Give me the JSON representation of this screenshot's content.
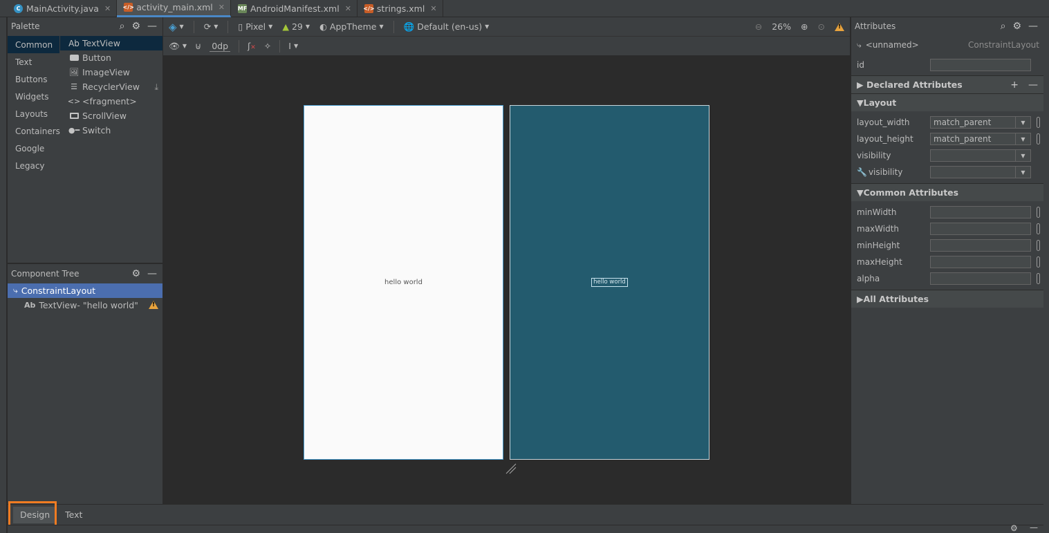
{
  "tabs": [
    {
      "label": "MainActivity.java",
      "icon": "java-class-icon",
      "active": false
    },
    {
      "label": "activity_main.xml",
      "icon": "layout-xml-icon",
      "active": true
    },
    {
      "label": "AndroidManifest.xml",
      "icon": "manifest-icon",
      "active": false
    },
    {
      "label": "strings.xml",
      "icon": "values-xml-icon",
      "active": false
    }
  ],
  "palette": {
    "title": "Palette",
    "categories": [
      "Common",
      "Text",
      "Buttons",
      "Widgets",
      "Layouts",
      "Containers",
      "Google",
      "Legacy"
    ],
    "selected_category": "Common",
    "items": [
      {
        "label": "TextView",
        "icon": "Ab"
      },
      {
        "label": "Button",
        "icon": "button-icon"
      },
      {
        "label": "ImageView",
        "icon": "image-icon"
      },
      {
        "label": "RecyclerView",
        "icon": "list-icon"
      },
      {
        "label": "<fragment>",
        "icon": "code-icon"
      },
      {
        "label": "ScrollView",
        "icon": "scroll-icon"
      },
      {
        "label": "Switch",
        "icon": "switch-icon"
      }
    ]
  },
  "component_tree": {
    "title": "Component Tree",
    "root": "ConstraintLayout",
    "child": "TextView- \"hello world\"",
    "child_icon": "Ab"
  },
  "toolbar": {
    "device": "Pixel",
    "api": "29",
    "theme": "AppTheme",
    "locale": "Default (en-us)",
    "zoom": "26%",
    "margin": "0dp"
  },
  "canvas": {
    "design_text": "hello world",
    "blueprint_text": "hello world"
  },
  "attributes": {
    "title": "Attributes",
    "component_name": "<unnamed>",
    "component_type": "ConstraintLayout",
    "id_label": "id",
    "declared": "Declared Attributes",
    "layout_section": "Layout",
    "layout_width_label": "layout_width",
    "layout_width_value": "match_parent",
    "layout_height_label": "layout_height",
    "layout_height_value": "match_parent",
    "visibility_label": "visibility",
    "tools_visibility_label": "visibility",
    "common_section": "Common Attributes",
    "minwidth": "minWidth",
    "maxwidth": "maxWidth",
    "minheight": "minHeight",
    "maxheight": "maxHeight",
    "alpha": "alpha",
    "all": "All Attributes"
  },
  "bottom_tabs": {
    "design": "Design",
    "text": "Text"
  },
  "colors": {
    "accent": "#4b6eaf",
    "blueprint": "#235b6e",
    "highlight": "#f07c22",
    "warning": "#e8a33d"
  }
}
